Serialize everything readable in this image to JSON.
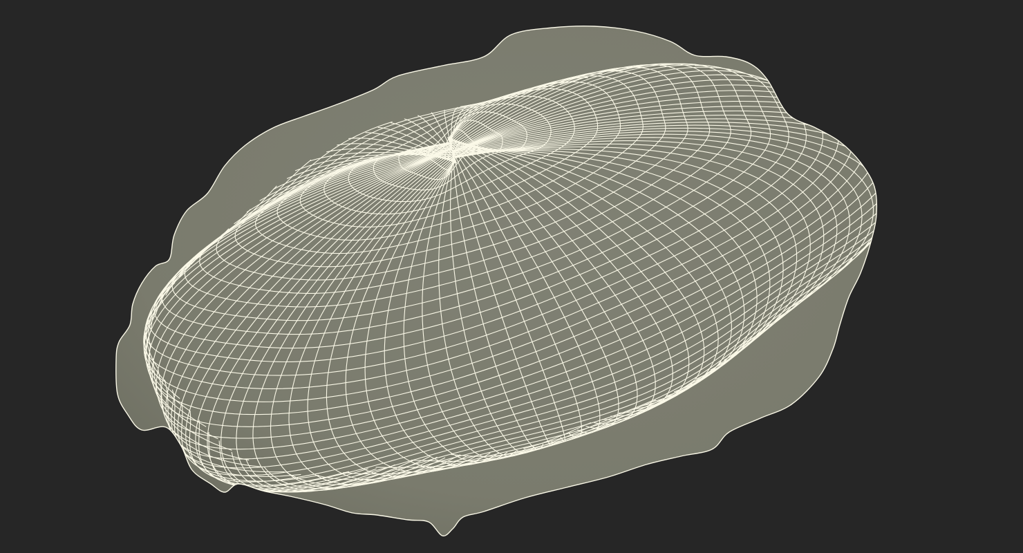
{
  "scene": {
    "background_color": "#262626",
    "mesh_fill_color": "#7d7e70",
    "mesh_shadow_color": "#6c6d60",
    "wire_color": "#fbf9e8",
    "object": "wireframe-3d-mesh"
  }
}
